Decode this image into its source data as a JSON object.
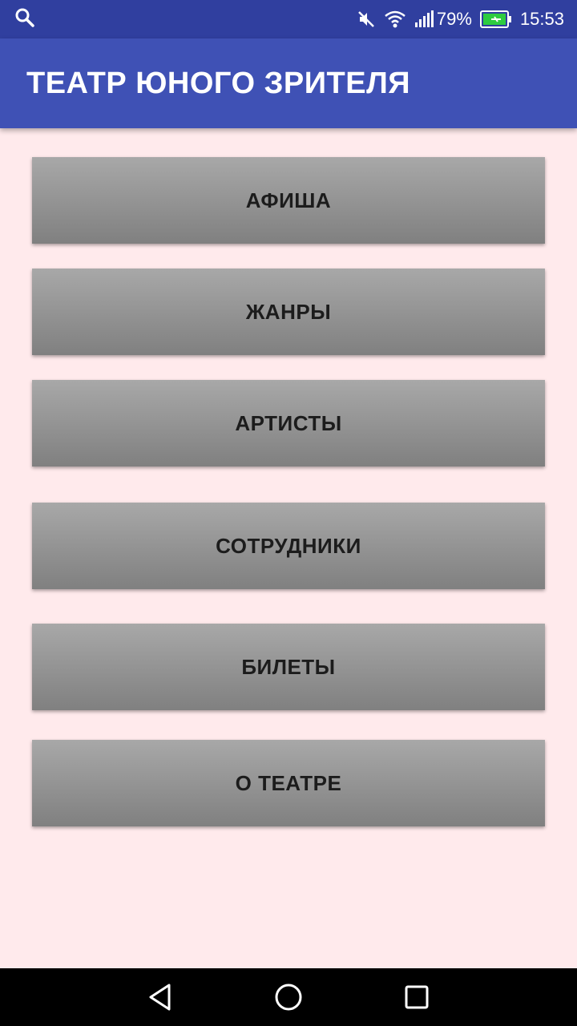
{
  "status_bar": {
    "battery_percent": "79%",
    "time": "15:53",
    "icons": [
      "search-icon",
      "muted-icon",
      "wifi-icon",
      "signal-icon",
      "battery-charging-icon"
    ],
    "battery_color": "#2ecc40"
  },
  "app_bar": {
    "title": "ТЕАТР ЮНОГО ЗРИТЕЛЯ",
    "color": "#3f51b5"
  },
  "menu": {
    "items": [
      {
        "label": "АФИША"
      },
      {
        "label": "ЖАНРЫ"
      },
      {
        "label": "АРТИСТЫ"
      },
      {
        "label": "СОТРУДНИКИ"
      },
      {
        "label": "БИЛЕТЫ"
      },
      {
        "label": "О ТЕАТРЕ"
      }
    ]
  },
  "nav_bar": {
    "icons": [
      "back-icon",
      "home-icon",
      "recents-icon"
    ]
  }
}
